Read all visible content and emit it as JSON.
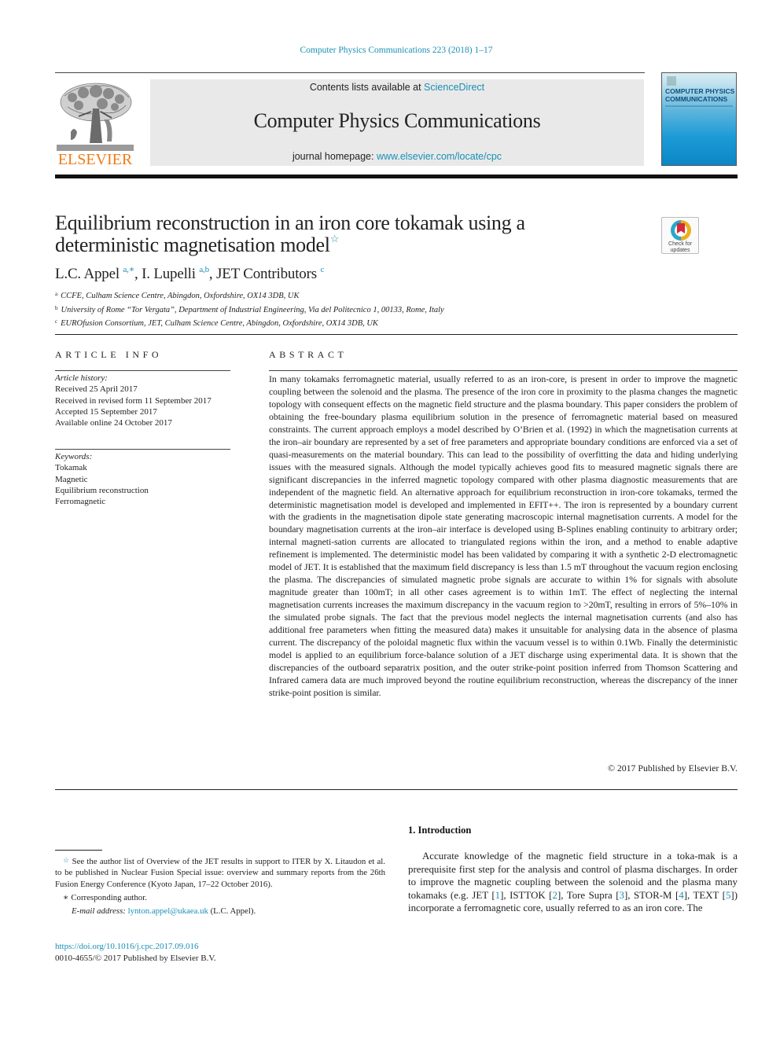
{
  "journal_ref": "Computer Physics Communications 223 (2018) 1–17",
  "masthead": {
    "publisher_logo": "ELSEVIER",
    "contents_prefix": "Contents lists available at ",
    "contents_link": "ScienceDirect",
    "journal_name": "Computer Physics Communications",
    "homepage_prefix": "journal homepage: ",
    "homepage_link": "www.elsevier.com/locate/cpc",
    "cover_title_line1": "COMPUTER PHYSICS",
    "cover_title_line2": "COMMUNICATIONS"
  },
  "crossmark": {
    "line1": "Check for",
    "line2": "updates"
  },
  "article": {
    "title_line1": "Equilibrium reconstruction in an iron core tokamak using a",
    "title_line2": "deterministic magnetisation model",
    "title_note_mark": "☆",
    "authors": [
      {
        "name": "L.C. Appel",
        "sup": "a,∗",
        "sep": ", "
      },
      {
        "name": "I. Lupelli",
        "sup": "a,b",
        "sep": ", "
      },
      {
        "name": "JET Contributors",
        "sup": "c",
        "sep": ""
      }
    ],
    "affiliations": [
      {
        "letter": "a",
        "text": "CCFE, Culham Science Centre, Abingdon, Oxfordshire, OX14 3DB, UK"
      },
      {
        "letter": "b",
        "text": "University of Rome “Tor Vergata”, Department of Industrial Engineering, Via del Politecnico 1, 00133, Rome, Italy"
      },
      {
        "letter": "c",
        "text": "EUROfusion Consortium, JET, Culham Science Centre, Abingdon, Oxfordshire, OX14 3DB, UK"
      }
    ]
  },
  "article_info": {
    "heading": "ARTICLE INFO",
    "history_label": "Article history:",
    "history": [
      "Received 25 April 2017",
      "Received in revised form 11 September 2017",
      "Accepted 15 September 2017",
      "Available online 24 October 2017"
    ],
    "keywords_label": "Keywords:",
    "keywords": [
      "Tokamak",
      "Magnetic",
      "Equilibrium reconstruction",
      "Ferromagnetic"
    ]
  },
  "abstract": {
    "heading": "ABSTRACT",
    "text": "In many tokamaks ferromagnetic material, usually referred to as an iron-core, is present in order to improve the magnetic coupling between the solenoid and the plasma. The presence of the iron core in proximity to the plasma changes the magnetic topology with consequent effects on the magnetic field structure and the plasma boundary. This paper considers the problem of obtaining the free-boundary plasma equilibrium solution in the presence of ferromagnetic material based on measured constraints. The current approach employs a model described by O’Brien et al. (1992) in which the magnetisation currents at the iron–air boundary are represented by a set of free parameters and appropriate boundary conditions are enforced via a set of quasi-measurements on the material boundary. This can lead to the possibility of overfitting the data and hiding underlying issues with the measured signals. Although the model typically achieves good fits to measured magnetic signals there are significant discrepancies in the inferred magnetic topology compared with other plasma diagnostic measurements that are independent of the magnetic field. An alternative approach for equilibrium reconstruction in iron-core tokamaks, termed the deterministic magnetisation model is developed and implemented in EFIT++. The iron is represented by a boundary current with the gradients in the magnetisation dipole state generating macroscopic internal magnetisation currents. A model for the boundary magnetisation currents at the iron–air interface is developed using B-Splines enabling continuity to arbitrary order; internal magneti-sation currents are allocated to triangulated regions within the iron, and a method to enable adaptive refinement is implemented. The deterministic model has been validated by comparing it with a synthetic 2-D electromagnetic model of JET. It is established that the maximum field discrepancy is less than 1.5 mT throughout the vacuum region enclosing the plasma. The discrepancies of simulated magnetic probe signals are accurate to within 1% for signals with absolute magnitude greater than 100mT; in all other cases agreement is to within 1mT. The effect of neglecting the internal magnetisation currents increases the maximum discrepancy in the vacuum region to >20mT, resulting in errors of 5%–10% in the simulated probe signals. The fact that the previous model neglects the internal magnetisation currents (and also has additional free parameters when fitting the measured data) makes it unsuitable for analysing data in the absence of plasma current. The discrepancy of the poloidal magnetic flux within the vacuum vessel is to within 0.1Wb. Finally the deterministic model is applied to an equilibrium force-balance solution of a JET discharge using experimental data. It is shown that the discrepancies of the outboard separatrix position, and the outer strike-point position inferred from Thomson Scattering and Infrared camera data are much improved beyond the routine equilibrium reconstruction, whereas the discrepancy of the inner strike-point position is similar.",
    "copyright": "© 2017 Published by Elsevier B.V."
  },
  "footnotes": {
    "star_note_mark": "☆",
    "star_note": "See the author list of Overview of the JET results in support to ITER by X. Litaudon et al. to be published in Nuclear Fusion Special issue: overview and summary reports from the 26th Fusion Energy Conference (Kyoto Japan, 17–22 October 2016).",
    "corresponding_mark": "∗",
    "corresponding": "Corresponding author.",
    "email_label": "E-mail address:",
    "email": "lynton.appel@ukaea.uk",
    "email_owner": " (L.C. Appel)."
  },
  "doi": {
    "link": "https://doi.org/10.1016/j.cpc.2017.09.016",
    "issn_line": "0010-4655/© 2017 Published by Elsevier B.V."
  },
  "introduction": {
    "heading": "1.  Introduction",
    "p1_a": "Accurate knowledge of the magnetic field structure in a toka-mak is a prerequisite first step for the analysis and control of plasma discharges. In order to improve the magnetic coupling between the solenoid and the plasma many tokamaks (e.g. JET [",
    "refs": [
      "1",
      "2",
      "3",
      "4",
      "5"
    ],
    "p1_b": "], ISTTOK [",
    "p1_c": "], Tore Supra [",
    "p1_d": "], STOR-M [",
    "p1_e": "], TEXT [",
    "p1_f": "]) incorporate a ferromagnetic core, usually referred to as an iron core. The"
  }
}
